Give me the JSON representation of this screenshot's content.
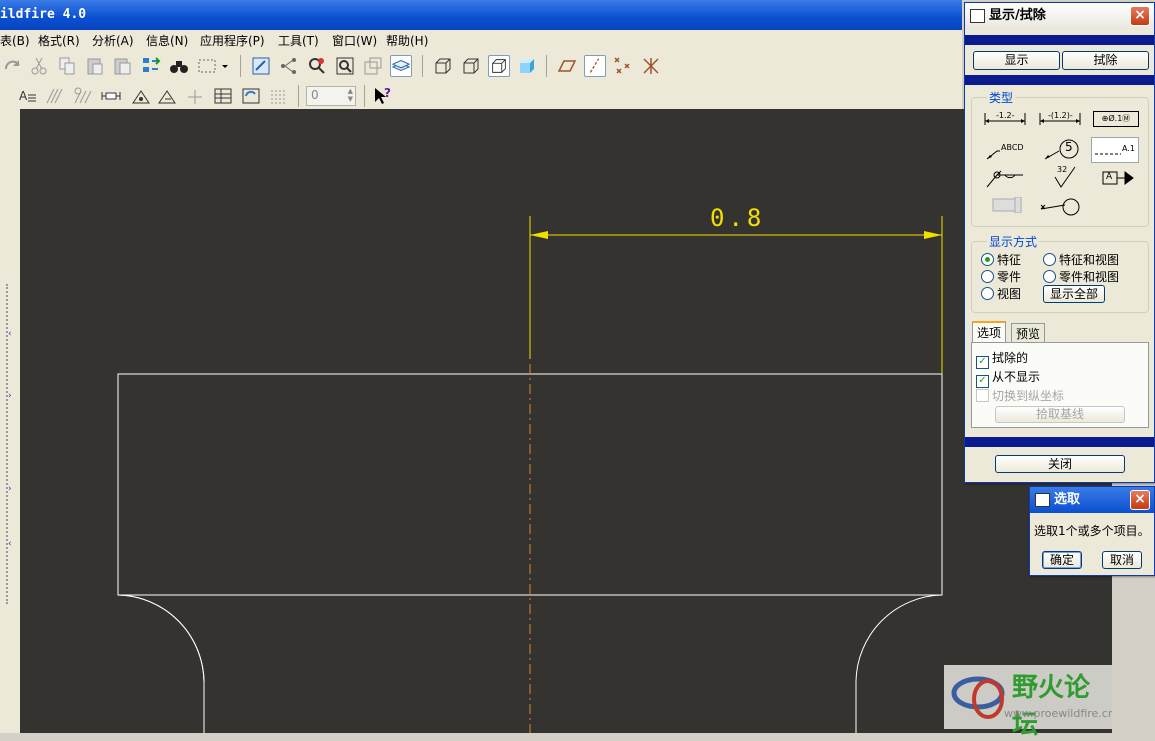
{
  "window": {
    "title": "ildfire 4.0"
  },
  "menu": [
    "表(B)",
    "格式(R)",
    "分析(A)",
    "信息(N)",
    "应用程序(P)",
    "工具(T)",
    "窗口(W)",
    "帮助(H)"
  ],
  "toolbar2": {
    "spin_value": "0"
  },
  "drawing": {
    "dimension": "0.8"
  },
  "show_erase_dialog": {
    "title": "显示/拭除",
    "show_button": "显示",
    "erase_button": "拭除",
    "type_label": "类型",
    "type_symbols": [
      "-1.2-",
      "-(1.2)-",
      "⊕Ø.1Ⓜ",
      "ABCD",
      "5",
      "A.1",
      "32",
      "A"
    ],
    "display_mode_label": "显示方式",
    "modes": [
      {
        "label": "特征",
        "selected": true
      },
      {
        "label": "特征和视图",
        "selected": false
      },
      {
        "label": "零件",
        "selected": false
      },
      {
        "label": "零件和视图",
        "selected": false
      },
      {
        "label": "视图",
        "selected": false
      }
    ],
    "show_all_button": "显示全部",
    "tabs": [
      "选项",
      "预览"
    ],
    "options": [
      {
        "label": "拭除的",
        "checked": true,
        "enabled": true
      },
      {
        "label": "从不显示",
        "checked": true,
        "enabled": true
      },
      {
        "label": "切换到纵坐标",
        "checked": false,
        "enabled": false
      }
    ],
    "pick_baseline_button": "拾取基线",
    "close_button": "关闭"
  },
  "select_dialog": {
    "title": "选取",
    "message": "选取1个或多个项目。",
    "ok_button": "确定",
    "cancel_button": "取消"
  },
  "watermark": {
    "title": "野火论坛",
    "url": "www.proewildfire.cn"
  },
  "colors": {
    "canvas": "#353330",
    "dimension": "#f0e000",
    "geometry": "#ffffff",
    "centerline": "#d08a30",
    "dialog_bar": "#0b1a8f"
  }
}
